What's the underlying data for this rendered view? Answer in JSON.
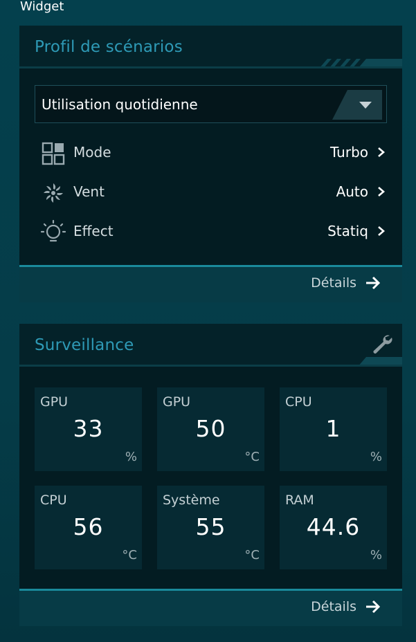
{
  "app": {
    "title": "Widget"
  },
  "profile": {
    "title": "Profil de scénarios",
    "dropdown": {
      "selected": "Utilisation quotidienne"
    },
    "settings": [
      {
        "label": "Mode",
        "value": "Turbo",
        "icon": "grid-icon"
      },
      {
        "label": "Vent",
        "value": "Auto",
        "icon": "fan-icon"
      },
      {
        "label": "Effect",
        "value": "Statiq",
        "icon": "light-bulb-icon"
      }
    ],
    "details_label": "Détails"
  },
  "monitoring": {
    "title": "Surveillance",
    "tiles": [
      {
        "label": "GPU",
        "value": "33",
        "unit": "%"
      },
      {
        "label": "GPU",
        "value": "50",
        "unit": "°C"
      },
      {
        "label": "CPU",
        "value": "1",
        "unit": "%"
      },
      {
        "label": "CPU",
        "value": "56",
        "unit": "°C"
      },
      {
        "label": "Système",
        "value": "55",
        "unit": "°C"
      },
      {
        "label": "RAM",
        "value": "44.6",
        "unit": "%"
      }
    ],
    "details_label": "Détails"
  },
  "colors": {
    "accent": "#2e9ab6",
    "panel_bg": "#031c22",
    "tile_bg": "#062a33",
    "footer_bg": "#073b46",
    "footer_border": "#1a8a9b"
  }
}
